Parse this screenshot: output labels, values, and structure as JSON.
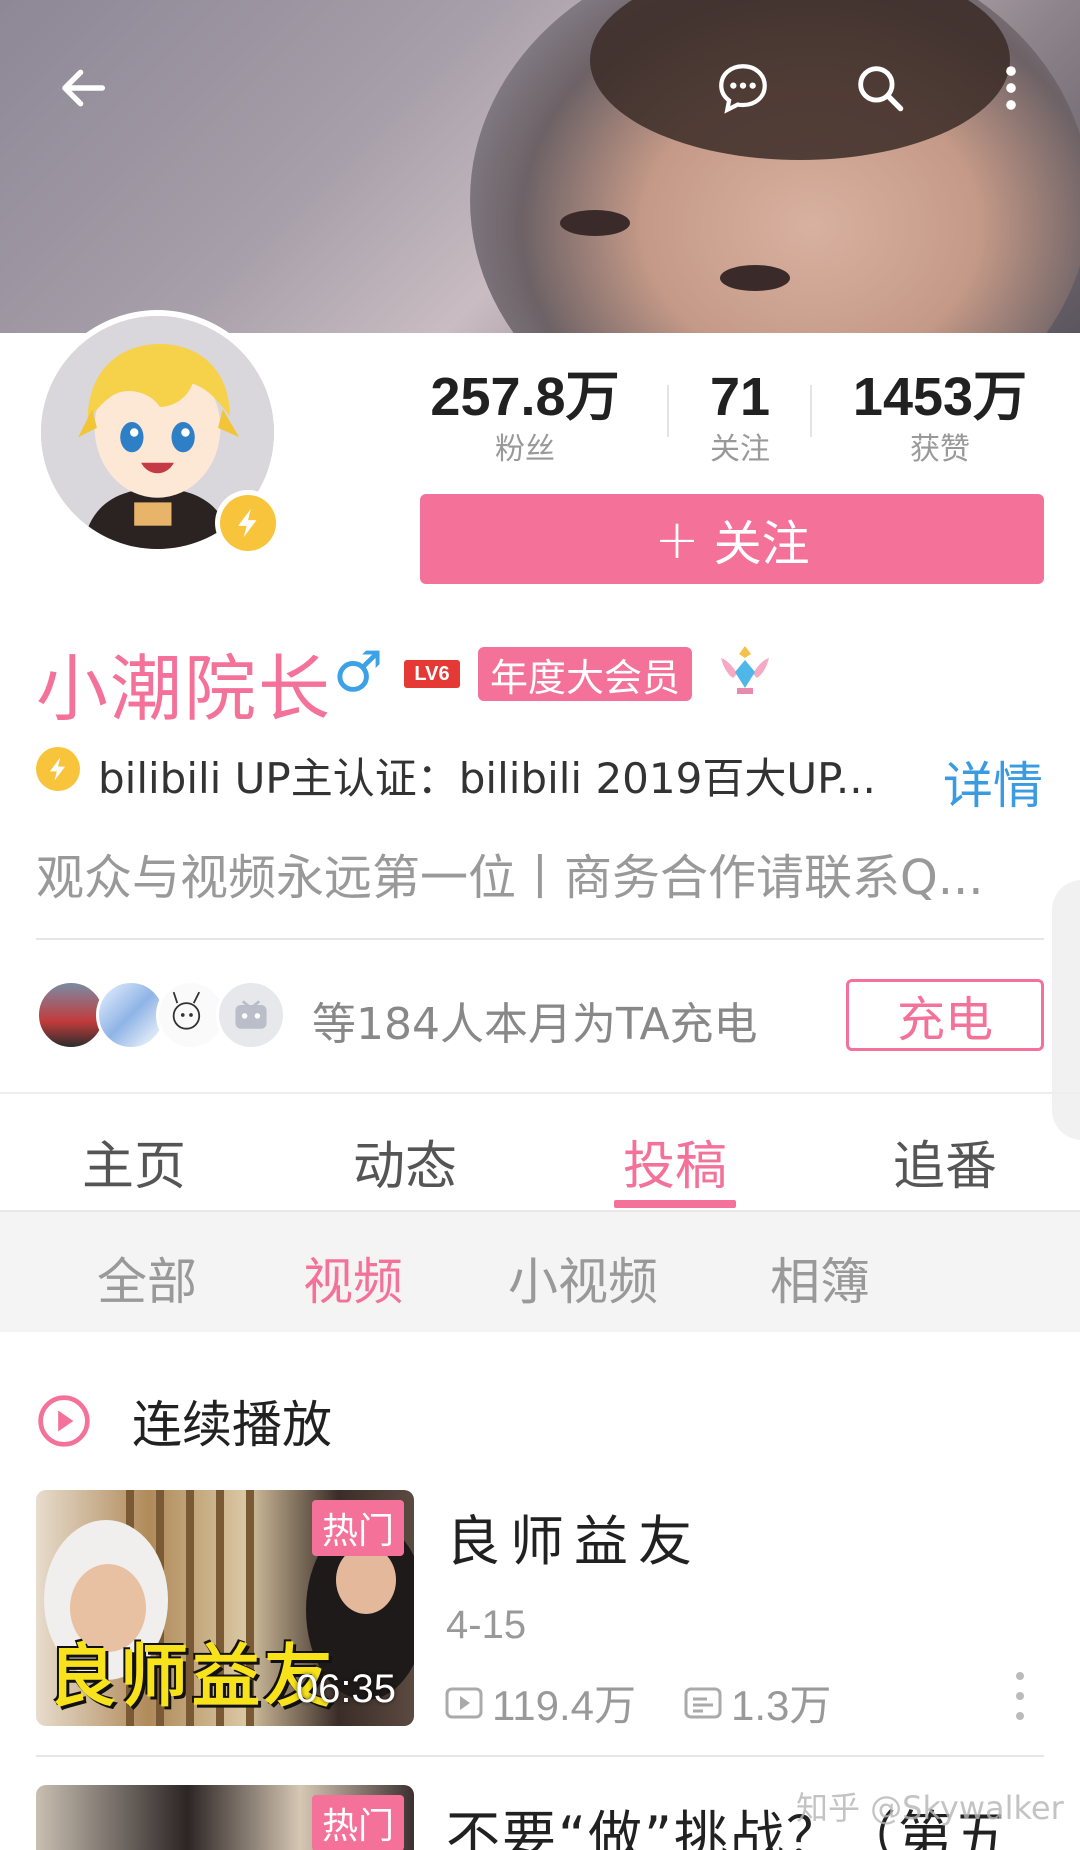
{
  "profile": {
    "name": "小潮院长",
    "gender_symbol": "♂",
    "level": "LV6",
    "vip_label": "年度大会员",
    "certification": "bilibili UP主认证：bilibili 2019百大UP...",
    "detail_label": "详情",
    "bio": "观众与视频永远第一位丨商务合作请联系Q..."
  },
  "stats": [
    {
      "value": "257.8万",
      "label": "粉丝"
    },
    {
      "value": "71",
      "label": "关注"
    },
    {
      "value": "1453万",
      "label": "获赞"
    }
  ],
  "follow_button": {
    "plus": "+",
    "label": "关注"
  },
  "charge": {
    "text": "等184人本月为TA充电",
    "button": "充电"
  },
  "tabs": [
    "主页",
    "动态",
    "投稿",
    "追番"
  ],
  "active_tab": "投稿",
  "subtabs": [
    "全部",
    "视频",
    "小视频",
    "相簿"
  ],
  "active_subtab": "视频",
  "autoplay_label": "连续播放",
  "videos": [
    {
      "badge": "热门",
      "duration": "06:35",
      "thumb_caption": "良师益友",
      "title": "良师益友",
      "date": "4-15",
      "views": "119.4万",
      "danmaku": "1.3万"
    },
    {
      "badge": "热门",
      "title": "不要“做”挑战？（第五"
    }
  ],
  "watermark": "知乎 @Skywalker",
  "colors": {
    "accent": "#f4729a",
    "link": "#3a9be0",
    "badge_gold": "#f7c43b"
  },
  "icons": [
    "back-arrow-icon",
    "message-icon",
    "search-icon",
    "more-vertical-icon",
    "lightning-icon",
    "play-circle-icon",
    "play-count-icon",
    "danmaku-icon"
  ]
}
